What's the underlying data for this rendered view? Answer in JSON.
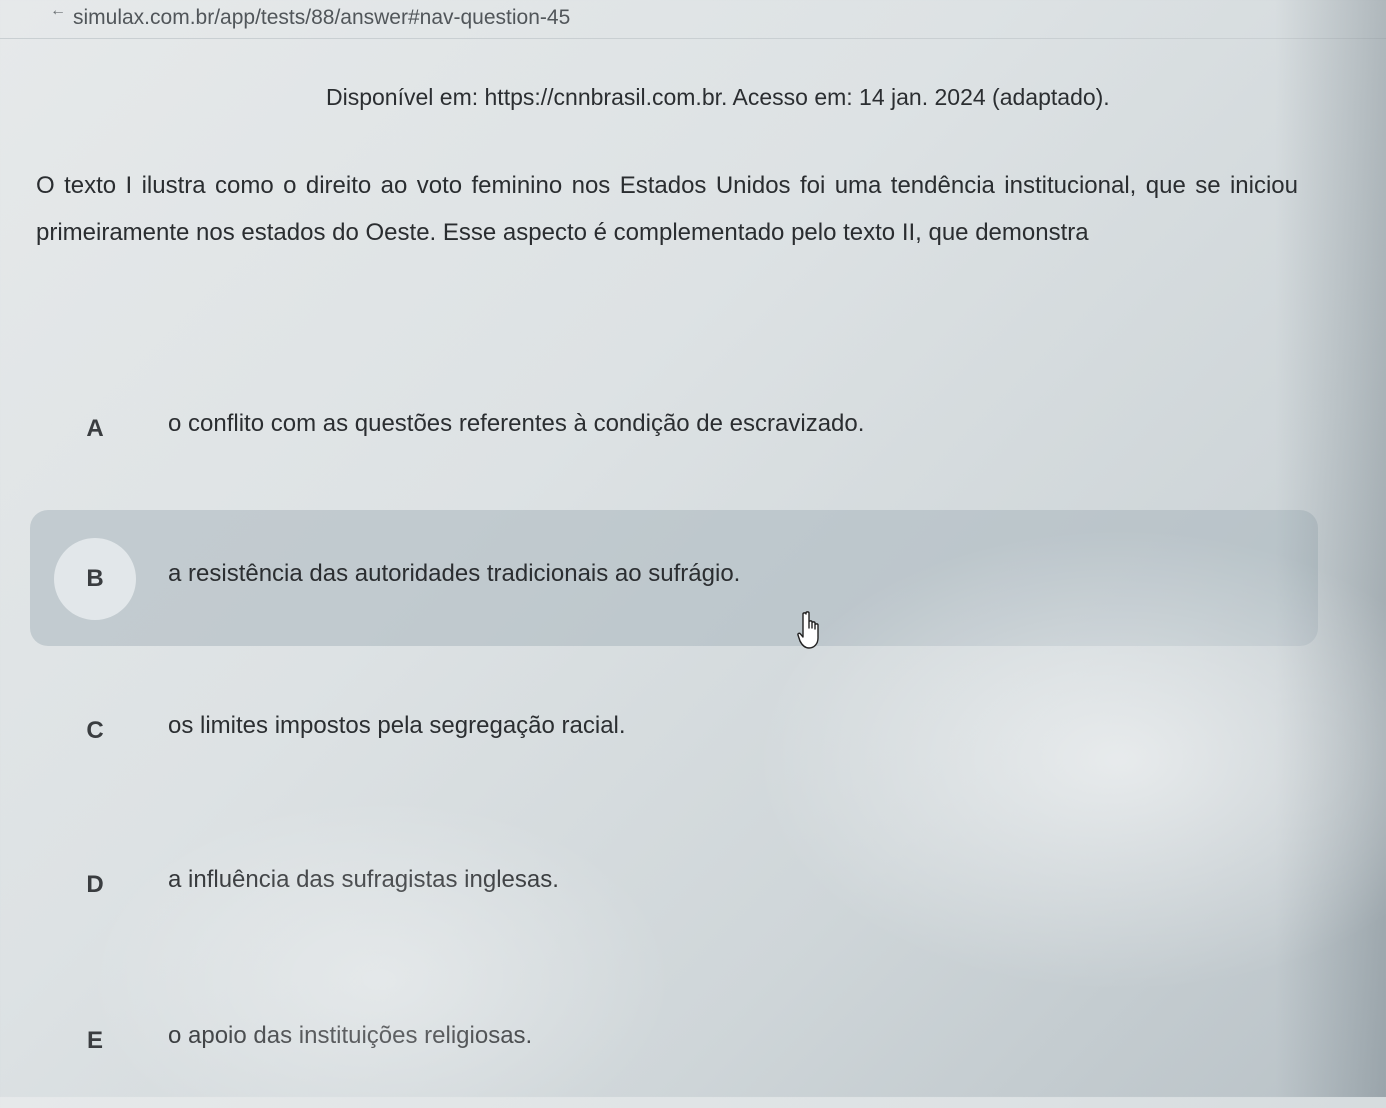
{
  "browser": {
    "url": "simulax.com.br/app/tests/88/answer#nav-question-45"
  },
  "question": {
    "source": "Disponível em: https://cnnbrasil.com.br. Acesso em: 14 jan. 2024 (adaptado).",
    "prompt": "O texto I ilustra como o direito ao voto feminino nos Estados Unidos foi uma tendência institucional, que se iniciou primeiramente nos estados do Oeste. Esse aspecto é complementado pelo texto II, que demonstra"
  },
  "options": [
    {
      "letter": "A",
      "text": "o conflito com as questões referentes à condição de escravizado."
    },
    {
      "letter": "B",
      "text": "a resistência das autoridades tradicionais ao sufrágio."
    },
    {
      "letter": "C",
      "text": "os limites impostos pela segregação racial."
    },
    {
      "letter": "D",
      "text": "a influência das sufragistas inglesas."
    },
    {
      "letter": "E",
      "text": "o apoio das instituições religiosas."
    }
  ],
  "state": {
    "hovered_option": "B",
    "cursor": "hand-pointer-icon"
  }
}
